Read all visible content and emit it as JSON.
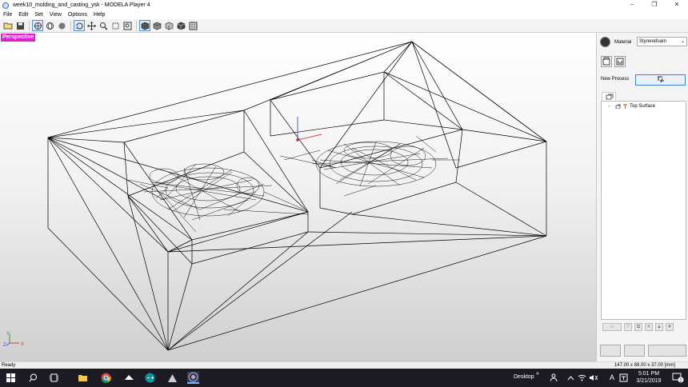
{
  "window": {
    "title": "week10_molding_and_casting_ysk - MODELA Player 4",
    "controls": [
      "minimize",
      "restore",
      "close"
    ]
  },
  "menu": [
    "File",
    "Edit",
    "Set",
    "View",
    "Options",
    "Help"
  ],
  "toolbar_icons": [
    "open-icon",
    "save-icon",
    "perspective-icon",
    "globe-icon",
    "sphere-icon",
    "rotate-icon",
    "move-icon",
    "zoom-icon",
    "fit-icon",
    "zoom-window-icon",
    "view-front-icon",
    "view-top-icon",
    "view-side-icon",
    "view-iso-icon",
    "grid-icon"
  ],
  "viewport": {
    "label": "Perspective",
    "axes": {
      "x": "X",
      "y": "Y",
      "z": "Z"
    }
  },
  "panel": {
    "material_label": "Material",
    "material_value": "Styrenefoam",
    "new_process_label": "New Process",
    "tree": [
      {
        "label": "Top Surface",
        "icon": "process-icon"
      }
    ]
  },
  "status": {
    "text": "Ready",
    "dimensions": "147.00 x 88.00 x 37.00 [mm]"
  },
  "taskbar": {
    "apps": [
      "windows-start-icon",
      "search-icon",
      "task-view-icon",
      "file-explorer-icon",
      "chrome-icon",
      "modela-icon",
      "arduino-icon",
      "vpanel-icon",
      "player-icon"
    ],
    "desktop_label": "Desktop",
    "tray_label": "A",
    "time": "5:01 PM",
    "date": "3/21/2019",
    "notification_count": "2"
  },
  "colors": {
    "view_label_bg": "#e020d0",
    "accent_blue": "#3c7fd8",
    "taskbar_bg": "#1b1b26"
  }
}
